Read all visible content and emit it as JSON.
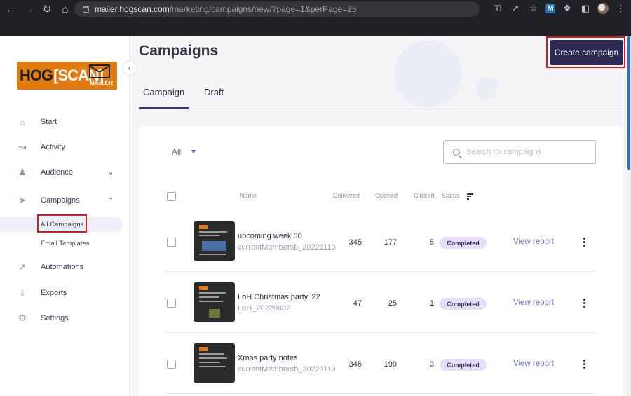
{
  "browser": {
    "url_host": "mailer.hogscan.com",
    "url_path": "/marketing/campaigns/new/?page=1&perPage=25",
    "extension_label": "M"
  },
  "sidebar": {
    "logo_hog": "HOG",
    "logo_scan": "[SCAN]",
    "logo_mailer": "MAILER",
    "items": [
      {
        "label": "Start",
        "icon": "home-icon"
      },
      {
        "label": "Activity",
        "icon": "chart-line-icon"
      },
      {
        "label": "Audience",
        "icon": "users-icon",
        "chevron": "down"
      },
      {
        "label": "Campaigns",
        "icon": "send-icon",
        "chevron": "up"
      },
      {
        "label": "Automations",
        "icon": "rocket-icon"
      },
      {
        "label": "Exports",
        "icon": "download-icon"
      },
      {
        "label": "Settings",
        "icon": "gear-icon"
      }
    ],
    "sub_items": [
      {
        "label": "All Campaigns",
        "active": true
      },
      {
        "label": "Email Templates",
        "active": false
      }
    ]
  },
  "main": {
    "title": "Campaigns",
    "create_button": "Create campaign",
    "tabs": [
      {
        "label": "Campaign",
        "active": true
      },
      {
        "label": "Draft",
        "active": false
      }
    ],
    "filter_label": "All",
    "search_placeholder": "Search for campaigns",
    "columns": {
      "name": "Name",
      "delivered": "Delivered",
      "opened": "Opened",
      "clicked": "Clicked",
      "status": "Status"
    },
    "rows": [
      {
        "name": "upcoming week 50",
        "list": "currentMembersb_20221119",
        "delivered": "345",
        "opened": "177",
        "clicked": "5",
        "status": "Completed",
        "action": "View report"
      },
      {
        "name": "LoH Christmas party '22",
        "list": "LoH_20220802",
        "delivered": "47",
        "opened": "25",
        "clicked": "1",
        "status": "Completed",
        "action": "View report"
      },
      {
        "name": "Xmas party notes",
        "list": "currentMembersb_20221119",
        "delivered": "346",
        "opened": "199",
        "clicked": "3",
        "status": "Completed",
        "action": "View report"
      }
    ]
  },
  "colors": {
    "accent": "#2d2a55",
    "logo_orange": "#e07b12",
    "badge_bg": "#e6ddfb",
    "link": "#6a6fc8",
    "highlight_red": "#cc1f1f"
  }
}
